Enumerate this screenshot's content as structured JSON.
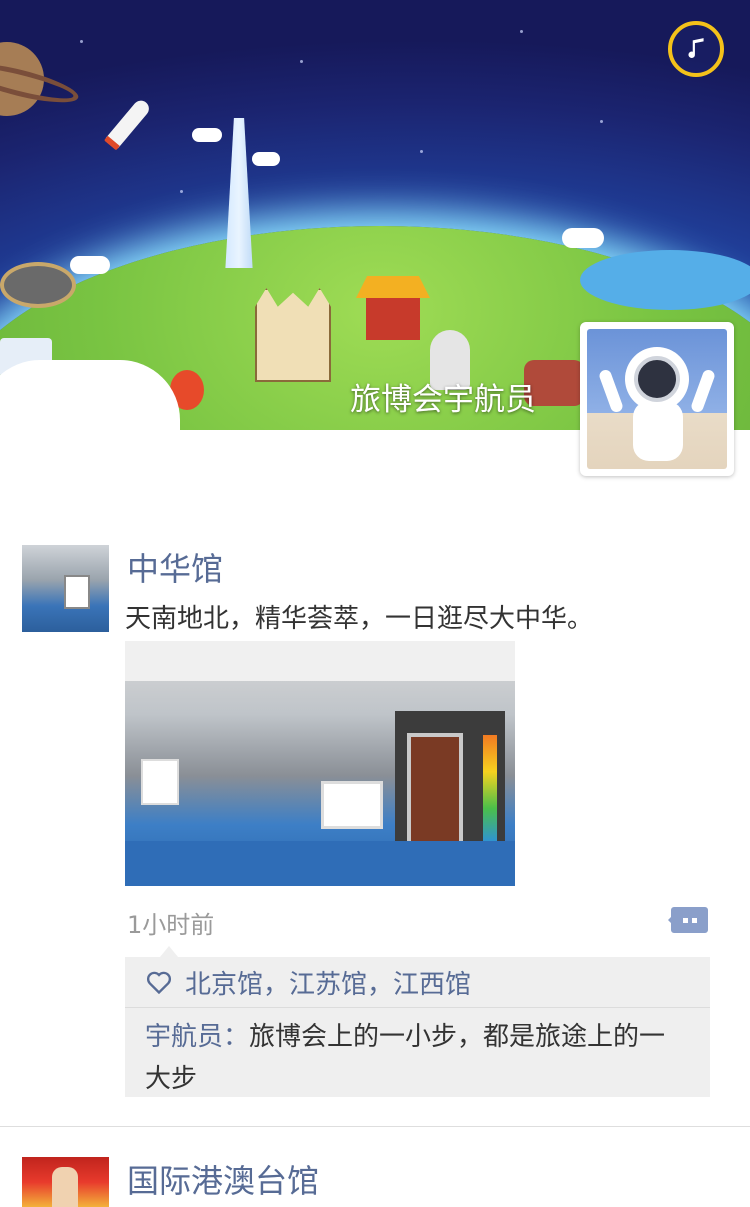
{
  "cover": {
    "title": "旅博会宇航员",
    "music_icon": "music-note-icon",
    "avatar_label": "astronaut-avatar"
  },
  "posts": [
    {
      "name": "中华馆",
      "text": "天南地北，精华荟萃，一日逛尽大中华。",
      "time": "1小时前",
      "likes": "北京馆，江苏馆，江西馆",
      "comment_author": "宇航员：",
      "comment_text": "旅博会上的一小步，都是旅途上的一大步"
    },
    {
      "name": "国际港澳台馆"
    }
  ],
  "colors": {
    "link": "#576b95",
    "music_ring": "#f4c21a",
    "comment_bg": "#efefef",
    "comment_icon": "#8a9fca"
  }
}
